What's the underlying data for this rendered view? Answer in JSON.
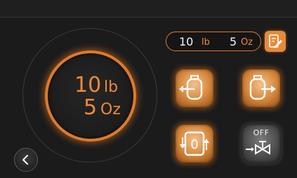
{
  "gauge": {
    "weight_lb": "10",
    "unit_lb": "lb",
    "weight_oz": "5",
    "unit_oz": "Oz"
  },
  "readout": {
    "lb_value": "10",
    "lb_unit": "lb",
    "oz_value": "5",
    "oz_unit": "Oz"
  },
  "controls": {
    "valve_state": "OFF",
    "zero_label": "0"
  },
  "colors": {
    "accent": "#e07a2a",
    "text_accent": "#f0883a",
    "background": "#1b1b1c"
  },
  "icons": {
    "edit": "edit-icon",
    "input": "tank-input-icon",
    "output": "tank-output-icon",
    "zero": "tare-zero-icon",
    "valve": "valve-icon",
    "back": "chevron-left-icon"
  }
}
